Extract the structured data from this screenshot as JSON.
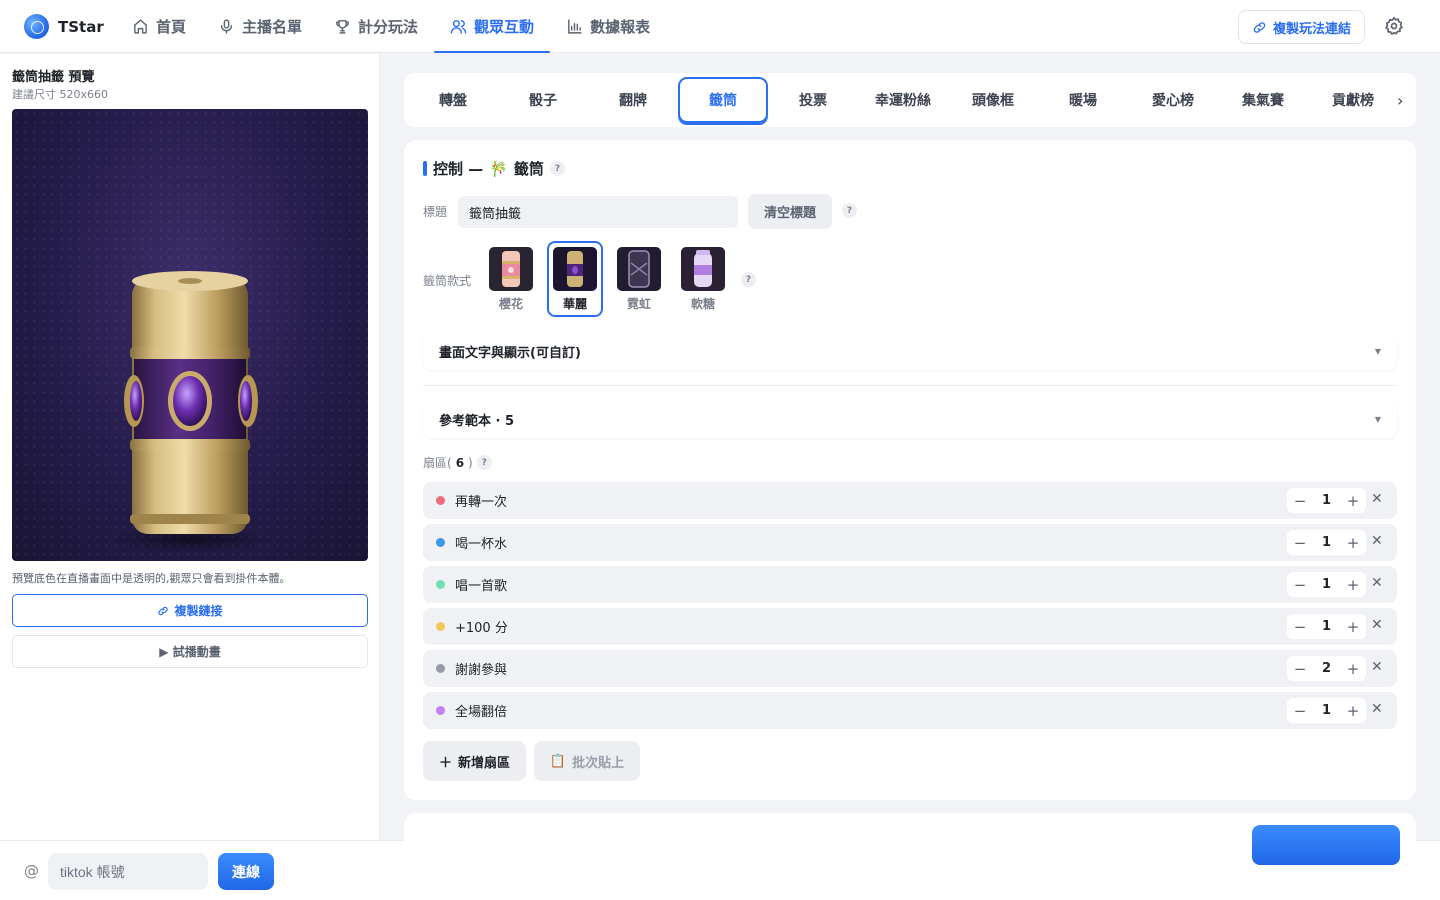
{
  "app": {
    "name": "TStar"
  },
  "nav": [
    {
      "label": "首頁",
      "icon": "home-icon"
    },
    {
      "label": "主播名單",
      "icon": "mic-icon"
    },
    {
      "label": "計分玩法",
      "icon": "trophy-icon"
    },
    {
      "label": "觀眾互動",
      "icon": "users-icon",
      "active": true
    },
    {
      "label": "數據報表",
      "icon": "bar-chart-icon"
    }
  ],
  "header": {
    "copy_link_label": "複製玩法連結",
    "accent": "#2b6ff0"
  },
  "preview": {
    "title": "籤筒抽籤 預覽",
    "size_note": "建議尺寸 520x660",
    "note": "預覽底色在直播畫面中是透明的,觀眾只會看到掛件本體。",
    "copy_button": "複製鏈接",
    "play_button": "▶ 試播動畫"
  },
  "bottom": {
    "at_symbol": "@",
    "account_placeholder": "tiktok 帳號",
    "connect_label": "連線"
  },
  "tabs": [
    "轉盤",
    "骰子",
    "翻牌",
    "籤筒",
    "投票",
    "幸運粉絲",
    "頭像框",
    "暖場",
    "愛心榜",
    "集氣賽",
    "貢獻榜"
  ],
  "active_tab": "籤筒",
  "control": {
    "heading_prefix": "控制 —",
    "heading_emoji": "🎋",
    "heading_name": "籤筒",
    "title_label": "標題",
    "title_value": "籤筒抽籤",
    "clear_title_label": "清空標題",
    "style_label": "籤筒款式",
    "styles": [
      {
        "name": "櫻花",
        "selected": false
      },
      {
        "name": "華麗",
        "selected": true
      },
      {
        "name": "霓虹",
        "selected": false
      },
      {
        "name": "軟糖",
        "selected": false
      }
    ],
    "collapse_text_display": "畫面文字與顯示(可自訂)",
    "collapse_reference": "參考範本 · 5",
    "sectors_label_prefix": "扇區(",
    "sectors_count": "6",
    "sectors_label_suffix": ")",
    "sectors": [
      {
        "label": "再轉一次",
        "count": "1",
        "color": "#ef6b7b"
      },
      {
        "label": "喝一杯水",
        "count": "1",
        "color": "#3a97ee"
      },
      {
        "label": "唱一首歌",
        "count": "1",
        "color": "#6fe0b4"
      },
      {
        "label": "+100 分",
        "count": "1",
        "color": "#f3c857"
      },
      {
        "label": "謝謝參與",
        "count": "2",
        "color": "#9a9aa6"
      },
      {
        "label": "全場翻倍",
        "count": "1",
        "color": "#c57ff0"
      }
    ],
    "add_sector_label": "新增扇區",
    "batch_paste_label": "批次貼上"
  }
}
